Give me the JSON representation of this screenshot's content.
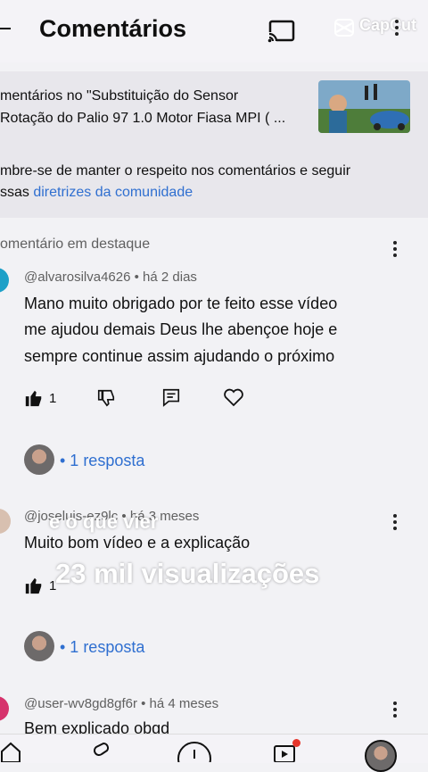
{
  "header": {
    "title": "Comentários",
    "watermark": "CapCut",
    "icons": [
      "back-arrow-icon",
      "cast-icon",
      "more-vert-icon"
    ]
  },
  "info_card": {
    "video_line_1": "mentários no \"Substituição do Sensor",
    "video_line_2": "Rotação do Palio 97 1.0 Motor Fiasa MPI ( ...",
    "notice_line_1": "mbre-se de manter o respeito nos comentários e seguir",
    "notice_line_2_prefix": "ssas ",
    "notice_link": "diretrizes da comunidade"
  },
  "comments": [
    {
      "badge": "omentário em destaque",
      "meta": "@alvarosilva4626 • há 2 dias",
      "text_lines": [
        "Mano muito obrigado por te feito esse vídeo",
        "me ajudou demais Deus lhe abençoe hoje e",
        "sempre continue assim ajudando o próximo"
      ],
      "likes": "1",
      "replies": "• 1 resposta"
    },
    {
      "meta": "@joseluis-ez9lc • há 3 meses",
      "text_lines": [
        "Muito bom vídeo e a explicação"
      ],
      "likes": "1",
      "replies": "• 1 resposta"
    },
    {
      "meta": "@user-wv8gd8gf6r • há 4 meses",
      "text_lines": [
        "Bem explicado obgd"
      ]
    }
  ],
  "overlay": {
    "line_1": "e o que vier",
    "line_2": "23 mil visualizações"
  },
  "colors": {
    "link": "#2f6fd0",
    "avatar_cyan": "#1da0c8",
    "avatar_pink": "#d6336c",
    "notification_dot": "#e5352b"
  }
}
